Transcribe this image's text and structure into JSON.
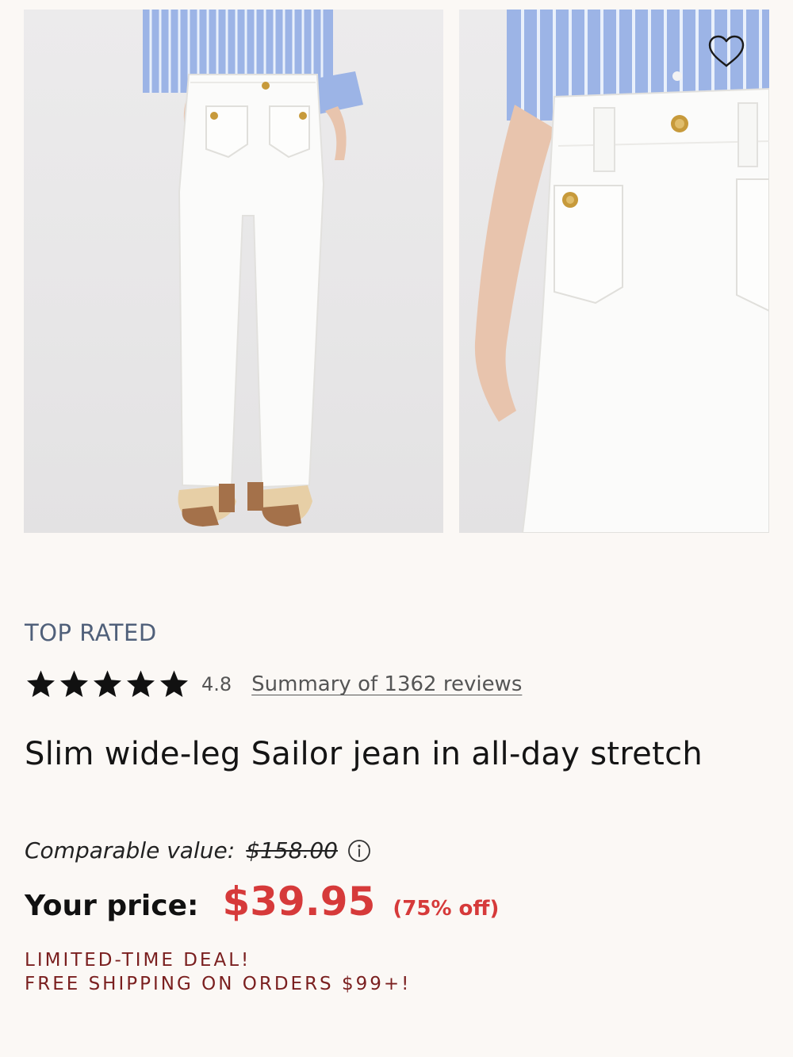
{
  "product": {
    "badge": "TOP RATED",
    "rating": "4.8",
    "star_count": 5,
    "reviews_link": "Summary of 1362 reviews",
    "title": "Slim wide-leg Sailor jean in all-day stretch"
  },
  "pricing": {
    "comparable_label": "Comparable value:",
    "comparable_price": "$158.00",
    "your_price_label": "Your price:",
    "your_price": "$39.95",
    "discount": "(75% off)"
  },
  "promo": {
    "line1": "LIMITED-TIME DEAL!",
    "line2": "FREE SHIPPING ON ORDERS $99+!"
  },
  "icons": {
    "favorite": "heart-icon",
    "info": "info-icon",
    "rating": "star-icon"
  },
  "colors": {
    "price_accent": "#d63a3a",
    "badge": "#50607a",
    "promo": "#7a1f1f",
    "background": "#fbf8f5"
  }
}
